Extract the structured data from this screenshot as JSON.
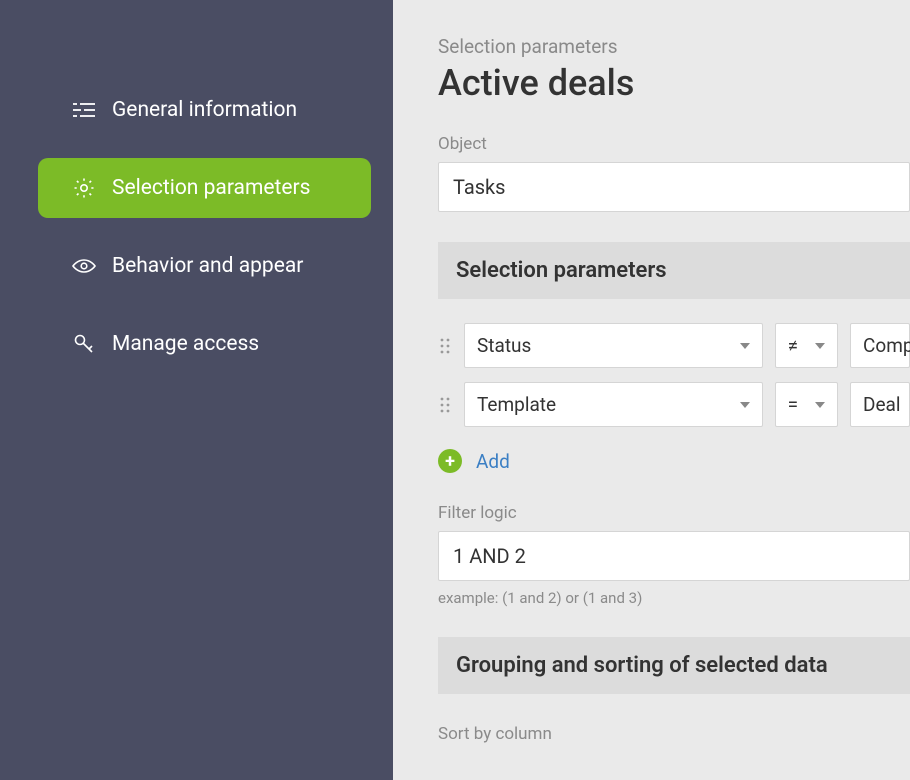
{
  "sidebar": {
    "items": [
      {
        "label": "General information"
      },
      {
        "label": "Selection parameters"
      },
      {
        "label": "Behavior and appear"
      },
      {
        "label": "Manage access"
      }
    ]
  },
  "main": {
    "breadcrumb": "Selection parameters",
    "title": "Active deals",
    "object": {
      "label": "Object",
      "value": "Tasks"
    },
    "selection_section_title": "Selection parameters",
    "filters": [
      {
        "field": "Status",
        "operator": "≠",
        "value": "Comp"
      },
      {
        "field": "Template",
        "operator": "=",
        "value": "Deal"
      }
    ],
    "add_label": "Add",
    "filter_logic": {
      "label": "Filter logic",
      "value": "1 AND 2",
      "hint": "example: (1 and 2) or (1 and 3)"
    },
    "grouping_section_title": "Grouping and sorting of selected data",
    "sort_label": "Sort by column"
  }
}
